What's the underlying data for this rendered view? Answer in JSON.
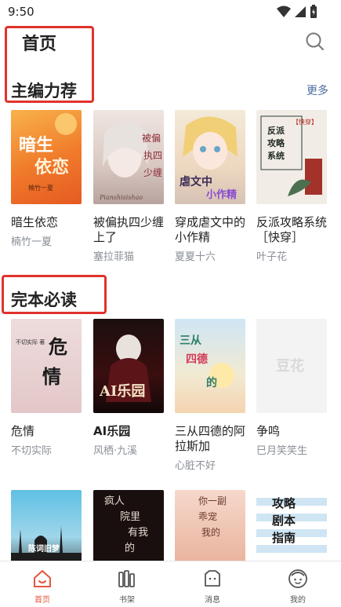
{
  "status_bar": {
    "time": "9:50"
  },
  "header": {
    "title": "首页"
  },
  "sections": [
    {
      "title": "主编力荐",
      "more": "更多",
      "books": [
        {
          "title": "暗生依恋",
          "author": "楠竹一夏",
          "cover_text": "暗生依恋",
          "cover_sub": "楠竹一夏"
        },
        {
          "title": "被偏执四少缠上了",
          "author": "塞拉菲猫",
          "cover_text": "被偏执四少缠上了"
        },
        {
          "title": "穿成虐文中的小作精",
          "author": "夏夏十六",
          "cover_text": "虐文中的小作精"
        },
        {
          "title": "反派攻略系统［快穿］",
          "author": "叶子花",
          "cover_text": "反派攻略系统",
          "cover_tag": "【快穿】"
        }
      ]
    },
    {
      "title": "完本必读",
      "books": [
        {
          "title": "危情",
          "author": "不切实际",
          "cover_text": "危情",
          "cover_sub": "不切实际 著"
        },
        {
          "title": "AI乐园",
          "author": "风栖·九溪",
          "cover_text": "AI乐园"
        },
        {
          "title": "三从四德的阿拉斯加",
          "author": "心脏不好",
          "cover_text": "三从四德的"
        },
        {
          "title": "争鸣",
          "author": "巳月笑笑生",
          "cover_text": "豆花"
        }
      ]
    },
    {
      "books": [
        {
          "cover_text": "陈词旧梦"
        },
        {
          "cover_text": "疯人院里有我的"
        },
        {
          "cover_text": "你一副乖宠我的"
        },
        {
          "cover_text": "攻略剧本指南"
        }
      ]
    }
  ],
  "bottom_nav": [
    {
      "label": "首页",
      "icon": "home-icon",
      "active": true
    },
    {
      "label": "书架",
      "icon": "bookshelf-icon",
      "active": false
    },
    {
      "label": "消息",
      "icon": "message-icon",
      "active": false
    },
    {
      "label": "我的",
      "icon": "profile-icon",
      "active": false
    }
  ],
  "colors": {
    "accent": "#e5563e",
    "highlight_box": "#e0332c",
    "more_link": "#4a6da0",
    "secondary_text": "#8a8f96"
  }
}
